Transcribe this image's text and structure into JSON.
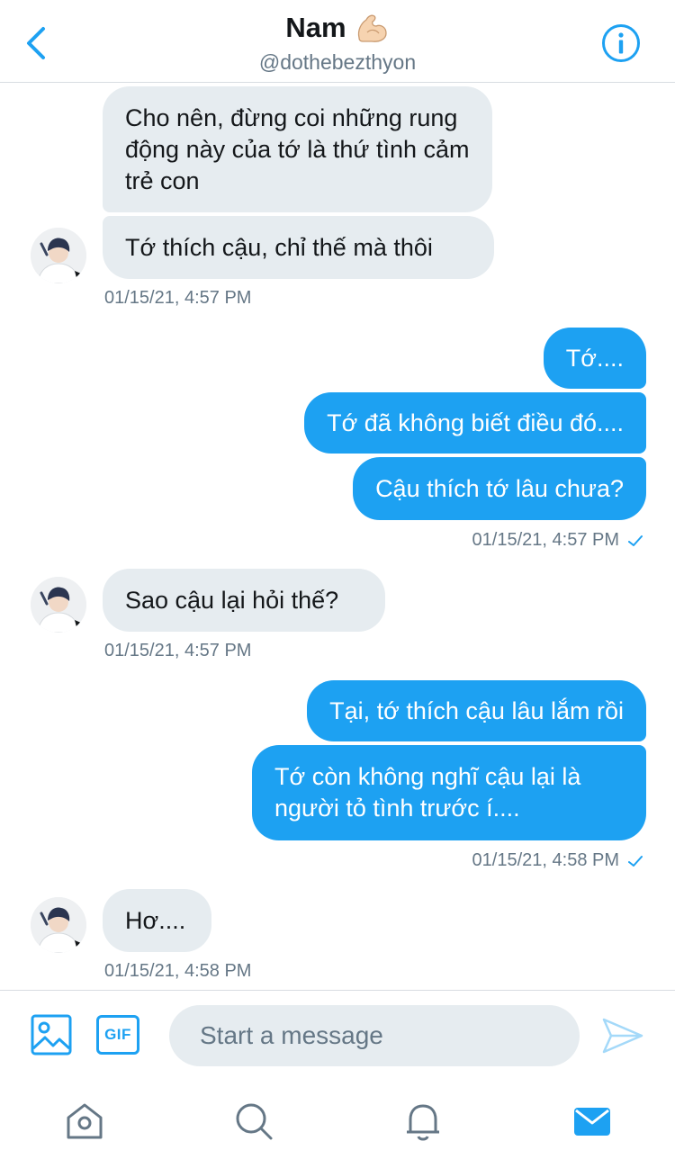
{
  "header": {
    "name": "Nam",
    "handle": "@dothebezthyon",
    "back_icon": "chevron-left-icon",
    "info_icon": "info-icon",
    "accent": "#1da1f2"
  },
  "messages": [
    {
      "side": "in",
      "text": "Cho nên, đừng coi những rung động này của tớ là thứ tình cảm trẻ con"
    },
    {
      "side": "in",
      "text": "Tớ thích cậu, chỉ thế mà thôi"
    },
    {
      "timestamp": "01/15/21, 4:57 PM"
    },
    {
      "side": "out",
      "text": "Tớ...."
    },
    {
      "side": "out",
      "text": "Tớ đã không biết điều đó...."
    },
    {
      "side": "out",
      "text": "Cậu thích tớ lâu chưa?"
    },
    {
      "timestamp": "01/15/21, 4:57 PM"
    },
    {
      "side": "in",
      "text": "Sao cậu lại hỏi thế?"
    },
    {
      "timestamp": "01/15/21, 4:57 PM"
    },
    {
      "side": "out",
      "text": "Tại, tớ thích cậu lâu lắm rồi"
    },
    {
      "side": "out",
      "text": "Tớ còn không nghĩ cậu lại là người tỏ tình trước í...."
    },
    {
      "timestamp": "01/15/21, 4:58 PM"
    },
    {
      "side": "in",
      "text": "Hơ...."
    },
    {
      "timestamp": "01/15/21, 4:58 PM"
    }
  ],
  "composer": {
    "placeholder": "Start a message",
    "gif_label": "GIF",
    "image_icon": "image-icon",
    "send_icon": "send-icon"
  },
  "tabs": [
    {
      "icon": "home-icon"
    },
    {
      "icon": "search-icon"
    },
    {
      "icon": "notifications-icon"
    },
    {
      "icon": "messages-icon",
      "active": true
    }
  ]
}
